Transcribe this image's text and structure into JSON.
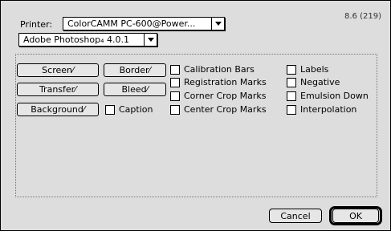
{
  "header": {
    "printer_label": "Printer:",
    "printer_value": "ColorCAMM PC-600@Power...",
    "version": "8.6 (219)"
  },
  "section": {
    "selected": "Adobe Photoshop₄ 4.0.1"
  },
  "buttons": {
    "screen": "Screen⁄",
    "transfer": "Transfer⁄",
    "background": "Background⁄",
    "border": "Border⁄",
    "bleed": "Bleed⁄"
  },
  "checkboxes": [
    {
      "label": "Caption",
      "checked": false
    },
    {
      "label": "Calibration Bars",
      "checked": false
    },
    {
      "label": "Registration Marks",
      "checked": false
    },
    {
      "label": "Corner Crop Marks",
      "checked": false
    },
    {
      "label": "Center Crop Marks",
      "checked": false
    },
    {
      "label": "Labels",
      "checked": false
    },
    {
      "label": "Negative",
      "checked": false
    },
    {
      "label": "Emulsion Down",
      "checked": false
    },
    {
      "label": "Interpolation",
      "checked": false
    }
  ],
  "footer": {
    "cancel": "Cancel",
    "ok": "OK"
  }
}
